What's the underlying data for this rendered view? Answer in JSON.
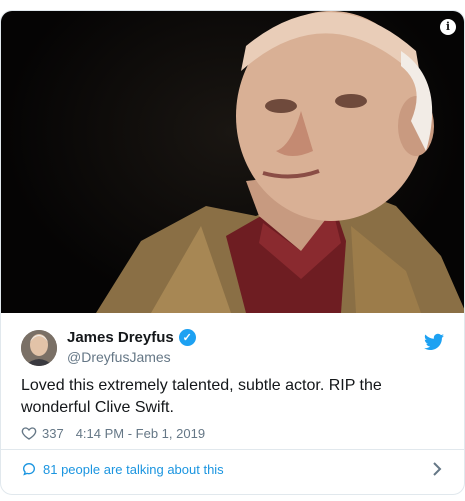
{
  "media": {
    "info_glyph": "i",
    "info_icon": "info-icon"
  },
  "user": {
    "display_name": "James Dreyfus",
    "handle": "@DreyfusJames",
    "verified_icon": "verified-badge-icon",
    "verified_glyph": "✓"
  },
  "tweet": {
    "text": "Loved this extremely talented, subtle actor. RIP the wonderful Clive Swift.",
    "likes": "337",
    "timestamp": "4:14 PM - Feb 1, 2019"
  },
  "footer": {
    "talking_text": "81 people are talking about this"
  },
  "colors": {
    "twitter_blue": "#1da1f2",
    "link_blue": "#1b95e0",
    "muted_text": "#657786",
    "border": "#e1e8ed"
  }
}
